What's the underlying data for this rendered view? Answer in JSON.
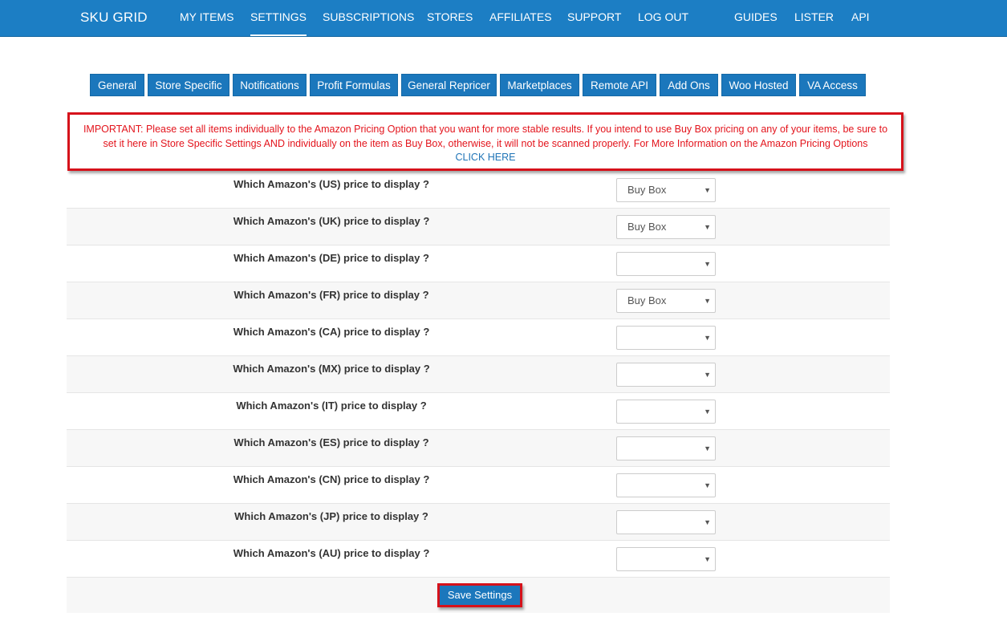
{
  "nav": {
    "brand": "SKU GRID",
    "links": [
      "MY ITEMS",
      "SETTINGS",
      "SUBSCRIPTIONS",
      "STORES",
      "AFFILIATES",
      "SUPPORT",
      "LOG OUT",
      "GUIDES",
      "LISTER",
      "API"
    ],
    "active": "SETTINGS"
  },
  "tabs": [
    "General",
    "Store Specific",
    "Notifications",
    "Profit Formulas",
    "General Repricer",
    "Marketplaces",
    "Remote API",
    "Add Ons",
    "Woo Hosted",
    "VA Access"
  ],
  "notice": {
    "line1": "IMPORTANT: Please set all items individually to the Amazon Pricing Option that you want for more stable results. If you intend to use Buy Box pricing on any of your items, be sure to",
    "line2": "set it here in Store Specific Settings AND individually on the item as Buy Box, otherwise, it will not be scanned properly. For More Information on the Amazon Pricing Options",
    "link": "CLICK HERE"
  },
  "rows": [
    {
      "label": "Which Amazon's (US) price to display ?",
      "value": "Buy Box"
    },
    {
      "label": "Which Amazon's (UK) price to display ?",
      "value": "Buy Box"
    },
    {
      "label": "Which Amazon's (DE) price to display ?",
      "value": ""
    },
    {
      "label": "Which Amazon's (FR) price to display ?",
      "value": "Buy Box"
    },
    {
      "label": "Which Amazon's (CA) price to display ?",
      "value": ""
    },
    {
      "label": "Which Amazon's (MX) price to display ?",
      "value": ""
    },
    {
      "label": "Which Amazon's (IT) price to display ?",
      "value": ""
    },
    {
      "label": "Which Amazon's (ES) price to display ?",
      "value": ""
    },
    {
      "label": "Which Amazon's (CN) price to display ?",
      "value": ""
    },
    {
      "label": "Which Amazon's (JP) price to display ?",
      "value": ""
    },
    {
      "label": "Which Amazon's (AU) price to display ?",
      "value": ""
    }
  ],
  "icons": {
    "select_caret": "caret-down-icon"
  },
  "save_label": "Save Settings",
  "colors": {
    "nav": "#1c7ec4",
    "tab": "#1b77bc",
    "highlight": "#d6121b",
    "notice_text": "#e3141c"
  }
}
